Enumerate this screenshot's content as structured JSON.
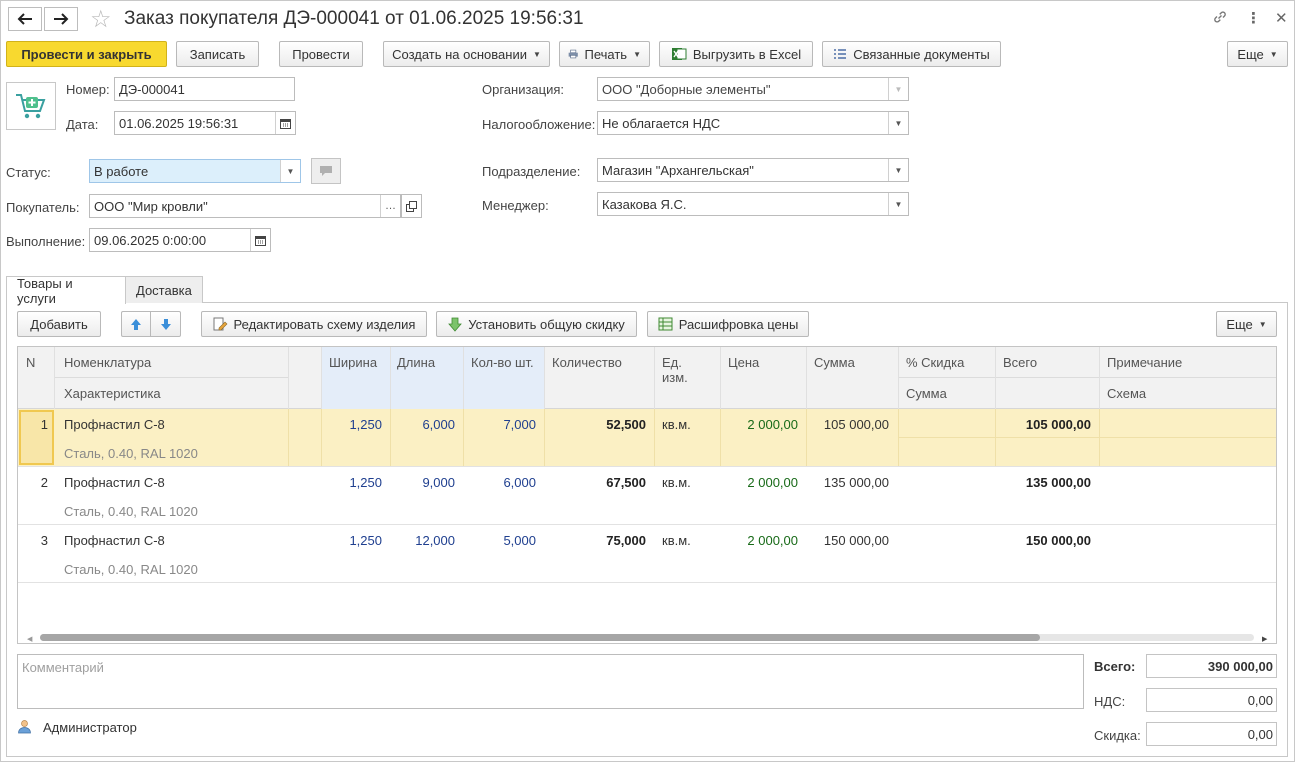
{
  "window": {
    "title": "Заказ покупателя ДЭ-000041 от 01.06.2025 19:56:31"
  },
  "toolbar": {
    "post_close": "Провести и закрыть",
    "save": "Записать",
    "post": "Провести",
    "create_based": "Создать на основании",
    "print": "Печать",
    "export_excel": "Выгрузить в Excel",
    "related_docs": "Связанные документы",
    "more": "Еще"
  },
  "form": {
    "number_label": "Номер:",
    "number_value": "ДЭ-000041",
    "date_label": "Дата:",
    "date_value": "01.06.2025 19:56:31",
    "org_label": "Организация:",
    "org_value": "ООО \"Доборные элементы\"",
    "tax_label": "Налогообложение:",
    "tax_value": "Не облагается НДС",
    "status_label": "Статус:",
    "status_value": "В работе",
    "dept_label": "Подразделение:",
    "dept_value": "Магазин \"Архангельская\"",
    "buyer_label": "Покупатель:",
    "buyer_value": "ООО \"Мир кровли\"",
    "manager_label": "Менеджер:",
    "manager_value": "Казакова Я.С.",
    "exec_label": "Выполнение:",
    "exec_value": "09.06.2025  0:00:00"
  },
  "tabs": [
    {
      "label": "Товары и услуги"
    },
    {
      "label": "Доставка"
    }
  ],
  "table_toolbar": {
    "add": "Добавить",
    "edit_scheme": "Редактировать схему изделия",
    "set_discount": "Установить общую скидку",
    "price_detail": "Расшифровка цены",
    "more": "Еще"
  },
  "table": {
    "headers": {
      "n": "N",
      "nomenclature": "Номенклатура",
      "characteristic": "Характеристика",
      "width": "Ширина",
      "length": "Длина",
      "pieces": "Кол-во шт.",
      "quantity": "Количество",
      "unit": "Ед. изм.",
      "price": "Цена",
      "sum": "Сумма",
      "discount_pct": "% Скидка",
      "discount_sum": "Сумма",
      "total": "Всего",
      "note": "Примечание",
      "scheme": "Схема"
    },
    "rows": [
      {
        "n": "1",
        "name": "Профнастил С-8",
        "char": "Сталь, 0.40, RAL 1020",
        "width": "1,250",
        "length": "6,000",
        "pieces": "7,000",
        "qty": "52,500",
        "unit": "кв.м.",
        "price": "2 000,00",
        "sum": "105 000,00",
        "total": "105 000,00"
      },
      {
        "n": "2",
        "name": "Профнастил С-8",
        "char": "Сталь, 0.40, RAL 1020",
        "width": "1,250",
        "length": "9,000",
        "pieces": "6,000",
        "qty": "67,500",
        "unit": "кв.м.",
        "price": "2 000,00",
        "sum": "135 000,00",
        "total": "135 000,00"
      },
      {
        "n": "3",
        "name": "Профнастил С-8",
        "char": "Сталь, 0.40, RAL 1020",
        "width": "1,250",
        "length": "12,000",
        "pieces": "5,000",
        "qty": "75,000",
        "unit": "кв.м.",
        "price": "2 000,00",
        "sum": "150 000,00",
        "total": "150 000,00"
      }
    ]
  },
  "footer": {
    "comment_placeholder": "Комментарий",
    "author": "Администратор",
    "total_label": "Всего:",
    "total_value": "390 000,00",
    "vat_label": "НДС:",
    "vat_value": "0,00",
    "discount_label": "Скидка:",
    "discount_value": "0,00"
  },
  "colors": {
    "primary_button": "#f8d92f",
    "selected_row": "#fbf0c4",
    "status_field": "#dceffb",
    "column_highlight": "#e8f0fb"
  }
}
